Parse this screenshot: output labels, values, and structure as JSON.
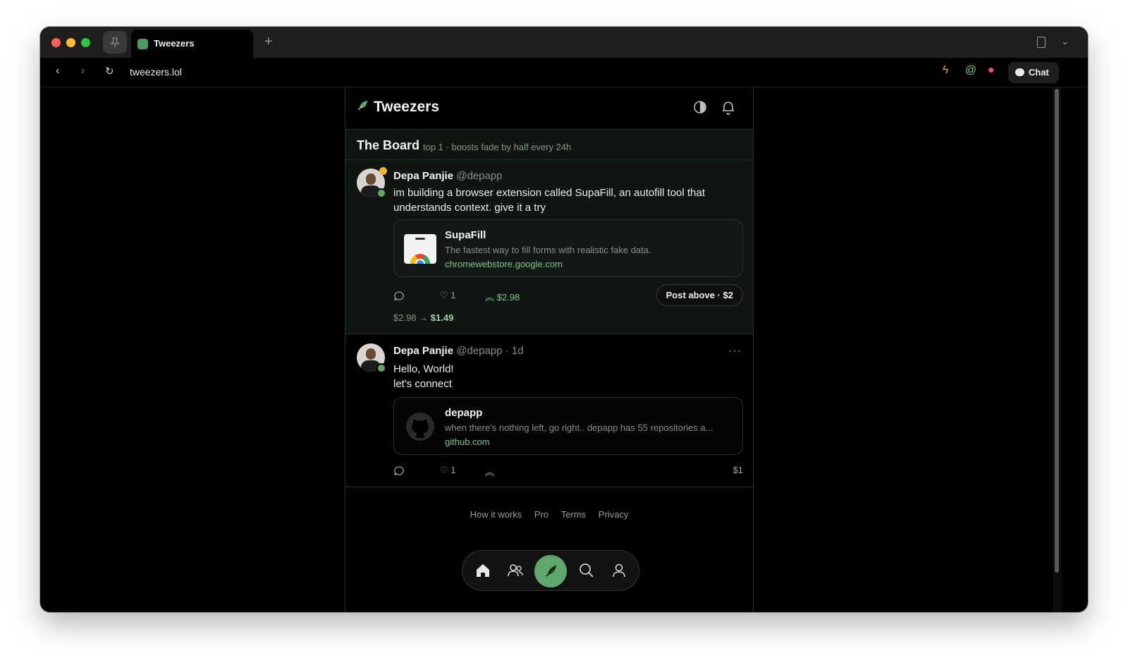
{
  "browser": {
    "tab_title": "Tweezers",
    "new_tab_label": "+",
    "url": "tweezers.lol",
    "chat_label": "Chat"
  },
  "app": {
    "brand": "Tweezers"
  },
  "board": {
    "title": "The Board",
    "subtitle": "top 1 · boosts fade by half every 24h"
  },
  "posts": [
    {
      "name": "Depa Panjie",
      "handle": "@depapp",
      "time": "",
      "text_lines": [
        "im building a browser extension called SupaFill, an autofill tool that",
        "understands context. give it a try"
      ],
      "card": {
        "title": "SupaFill",
        "description": "The fastest way to fill forms with realistic fake data.",
        "domain": "chromewebstore.google.com"
      },
      "likes": "1",
      "boost_amount": "$2.98",
      "post_above_label": "Post above · $2",
      "decay_from": "$2.98 →",
      "decay_to": "$1.49"
    },
    {
      "name": "Depa Panjie",
      "handle": "@depapp · 1d",
      "text_lines": [
        "Hello, World!",
        "let's connect"
      ],
      "card": {
        "title": "depapp",
        "description": "when there's nothing left, go right.. depapp has 55 repositories a...",
        "domain": "github.com"
      },
      "likes": "1",
      "price": "$1"
    }
  ],
  "footer": {
    "links": [
      "How it works",
      "Pro",
      "Terms",
      "Privacy"
    ]
  },
  "colors": {
    "accent": "#5fa86c",
    "link": "#7cc48a",
    "board_bg": "#0f1612"
  },
  "icons": {
    "dock": [
      "home-icon",
      "people-icon",
      "compose-icon",
      "search-icon",
      "profile-icon"
    ]
  }
}
